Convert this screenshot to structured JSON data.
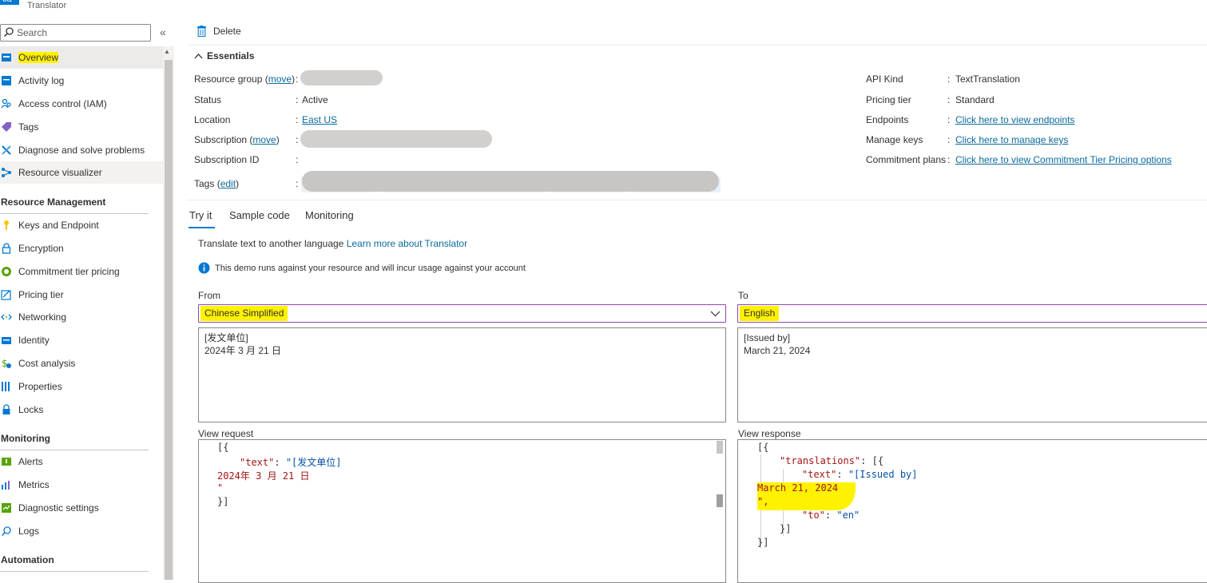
{
  "app": {
    "logo_text": "ca",
    "title": "Translator"
  },
  "sidebar": {
    "search_placeholder": "Search",
    "collapse_glyph": "«",
    "items_top": [
      {
        "label": "Overview",
        "icon": "overview-icon",
        "color": "#0078d4"
      },
      {
        "label": "Activity log",
        "icon": "activity-log-icon",
        "color": "#0078d4"
      },
      {
        "label": "Access control (IAM)",
        "icon": "iam-icon",
        "color": "#0078d4"
      },
      {
        "label": "Tags",
        "icon": "tag-icon",
        "color": "#7b3ff2"
      },
      {
        "label": "Diagnose and solve problems",
        "icon": "wrench-icon",
        "color": "#0078d4"
      },
      {
        "label": "Resource visualizer",
        "icon": "visualizer-icon",
        "color": "#0078d4"
      }
    ],
    "section_resource_management": "Resource Management",
    "items_rm": [
      {
        "label": "Keys and Endpoint",
        "icon": "key-icon",
        "color": "#f2c811"
      },
      {
        "label": "Encryption",
        "icon": "lock-icon",
        "color": "#0078d4"
      },
      {
        "label": "Commitment tier pricing",
        "icon": "commitment-icon",
        "color": "#57a300"
      },
      {
        "label": "Pricing tier",
        "icon": "pricing-icon",
        "color": "#0078d4"
      },
      {
        "label": "Networking",
        "icon": "networking-icon",
        "color": "#0078d4"
      },
      {
        "label": "Identity",
        "icon": "identity-icon",
        "color": "#0078d4"
      },
      {
        "label": "Cost analysis",
        "icon": "cost-icon",
        "color": "#57a300"
      },
      {
        "label": "Properties",
        "icon": "properties-icon",
        "color": "#0078d4"
      },
      {
        "label": "Locks",
        "icon": "lock-icon",
        "color": "#0078d4"
      }
    ],
    "section_monitoring": "Monitoring",
    "items_mon": [
      {
        "label": "Alerts",
        "icon": "alerts-icon",
        "color": "#57a300"
      },
      {
        "label": "Metrics",
        "icon": "metrics-icon",
        "color": "#0078d4"
      },
      {
        "label": "Diagnostic settings",
        "icon": "diagnostic-icon",
        "color": "#57a300"
      },
      {
        "label": "Logs",
        "icon": "logs-icon",
        "color": "#0078d4"
      }
    ],
    "section_automation": "Automation"
  },
  "toolbar": {
    "delete_label": "Delete"
  },
  "essentials": {
    "header": "Essentials",
    "left": {
      "resource_group_label": "Resource group",
      "move": "move",
      "status_label": "Status",
      "status_value": "Active",
      "location_label": "Location",
      "location_value": "East US",
      "subscription_label": "Subscription",
      "subscription_id_label": "Subscription ID",
      "tags_label": "Tags",
      "edit": "edit"
    },
    "right": {
      "api_kind_label": "API Kind",
      "api_kind_value": "TextTranslation",
      "pricing_tier_label": "Pricing tier",
      "pricing_tier_value": "Standard",
      "endpoints_label": "Endpoints",
      "endpoints_value": "Click here to view endpoints",
      "manage_keys_label": "Manage keys",
      "manage_keys_value": "Click here to manage keys",
      "commitment_label": "Commitment plans",
      "commitment_value": "Click here to view Commitment Tier Pricing options"
    }
  },
  "tabs": [
    "Try it",
    "Sample code",
    "Monitoring"
  ],
  "try_it": {
    "intro": "Translate text to another language",
    "learn_more": "Learn more about Translator",
    "info": "This demo runs against your resource and will incur usage against your account",
    "from_label": "From",
    "from_value": "Chinese Simplified",
    "to_label": "To",
    "to_value": "English",
    "source_lines": [
      "[发文单位]",
      "2024年 3 月 21 日"
    ],
    "target_lines": [
      "[Issued by]",
      "March 21, 2024"
    ],
    "view_request_label": "View request",
    "view_response_label": "View response",
    "request": {
      "l1": "[{",
      "l2_key": "\"text\"",
      "l2_sep": ": ",
      "l2_val": "\"[发文单位]",
      "l3": "2024年 3 月 21 日",
      "l4": "\"",
      "l5": "}]"
    },
    "response": {
      "l1": "[{",
      "l2_key": "\"translations\"",
      "l2_rest": ": [{",
      "l3_key": "\"text\"",
      "l3_sep": ": ",
      "l3_val": "\"[Issued by]",
      "l4": "March 21, 2024",
      "l5": "\",",
      "l6_key": "\"to\"",
      "l6_sep": ": ",
      "l6_val": "\"en\"",
      "l7": "}]",
      "l8": "}]"
    }
  },
  "colors": {
    "highlight": "#fff200",
    "accent": "#0078d4",
    "dropdown_border": "#8a4bac"
  }
}
